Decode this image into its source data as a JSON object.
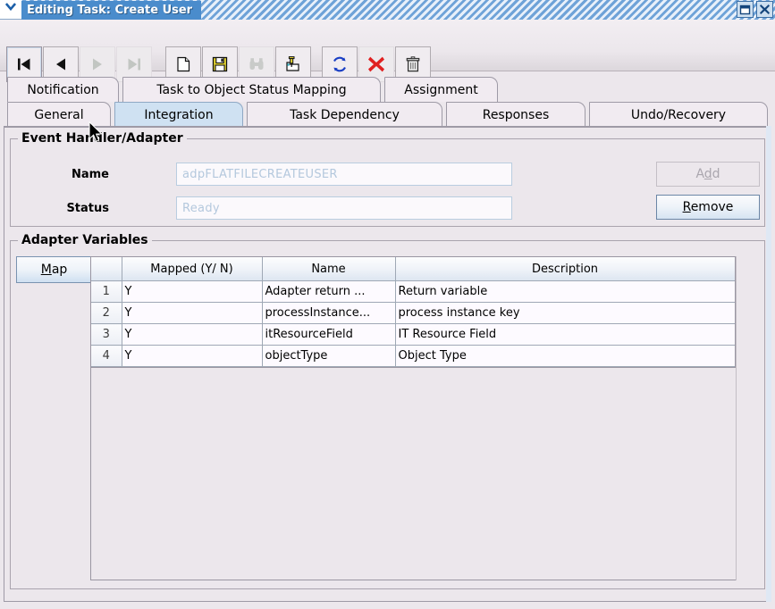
{
  "window": {
    "title": "Editing Task: Create User",
    "sysmenu_icon": "chevron-down-icon",
    "buttons": [
      {
        "name": "restore-button",
        "icon": "restore-icon"
      },
      {
        "name": "close-button",
        "icon": "close-icon"
      }
    ]
  },
  "toolbar": {
    "buttons": [
      {
        "name": "first-record-button",
        "icon": "first-record-icon",
        "enabled": true,
        "focused": true
      },
      {
        "name": "previous-record-button",
        "icon": "previous-record-icon",
        "enabled": true,
        "focused": false
      },
      {
        "name": "next-record-button",
        "icon": "next-record-icon",
        "enabled": false,
        "focused": false
      },
      {
        "name": "last-record-button",
        "icon": "last-record-icon",
        "enabled": false,
        "focused": false
      },
      {
        "name": "new-button",
        "icon": "new-document-icon",
        "enabled": true,
        "focused": false
      },
      {
        "name": "save-button",
        "icon": "save-floppy-icon",
        "enabled": true,
        "focused": false
      },
      {
        "name": "find-button",
        "icon": "binoculars-icon",
        "enabled": false,
        "focused": false
      },
      {
        "name": "notes-button",
        "icon": "pushpin-folder-icon",
        "enabled": true,
        "focused": false
      },
      {
        "name": "refresh-button",
        "icon": "refresh-arrows-icon",
        "enabled": true,
        "focused": false
      },
      {
        "name": "delete-button",
        "icon": "red-x-icon",
        "enabled": true,
        "focused": false
      },
      {
        "name": "trash-button",
        "icon": "trash-can-icon",
        "enabled": true,
        "focused": false
      }
    ]
  },
  "tabs": {
    "row1": [
      {
        "label": "Notification",
        "selected": false
      },
      {
        "label": "Task to Object Status Mapping",
        "selected": false
      },
      {
        "label": "Assignment",
        "selected": false
      }
    ],
    "row2": [
      {
        "label": "General",
        "selected": false
      },
      {
        "label": "Integration",
        "selected": true
      },
      {
        "label": "Task Dependency",
        "selected": false
      },
      {
        "label": "Responses",
        "selected": false
      },
      {
        "label": "Undo/Recovery",
        "selected": false
      }
    ]
  },
  "event_handler": {
    "group_title": "Event Handler/Adapter",
    "name_label": "Name",
    "name_value": "adpFLATFILECREATEUSER",
    "status_label": "Status",
    "status_value": "Ready",
    "add_button": {
      "label": "Add",
      "mnemonic": "d",
      "enabled": false
    },
    "remove_button": {
      "label": "Remove",
      "mnemonic": "R",
      "enabled": true
    }
  },
  "adapter_variables": {
    "group_title": "Adapter Variables",
    "map_button": {
      "label": "Map",
      "mnemonic": "M",
      "enabled": true
    },
    "columns": [
      "",
      "Mapped (Y/ N)",
      "Name",
      "Description"
    ],
    "rows": [
      {
        "num": "1",
        "mapped": "Y",
        "name": "Adapter return ...",
        "description": "Return variable"
      },
      {
        "num": "2",
        "mapped": "Y",
        "name": "processInstance...",
        "description": "process instance key"
      },
      {
        "num": "3",
        "mapped": "Y",
        "name": "itResourceField",
        "description": "IT Resource Field"
      },
      {
        "num": "4",
        "mapped": "Y",
        "name": "objectType",
        "description": "Object Type"
      }
    ]
  },
  "colors": {
    "title_active": "#4a8ccc",
    "panel_bg": "#ece7ec",
    "selected_tab": "#cfe1f2",
    "field_text": "#b4c8dd",
    "delete_red": "#e02020",
    "refresh_blue": "#1a3fc4",
    "floppy_yellow": "#e8d832"
  }
}
